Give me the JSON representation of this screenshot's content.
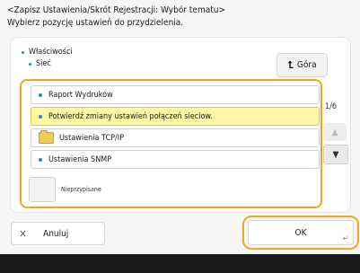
{
  "header": {
    "line1": "<Zapisz Ustawienia/Skrót Rejestracji: Wybór tematu>",
    "line2": "Wybierz pozycję ustawień do przydzielenia."
  },
  "tree": {
    "parent": "Właściwości",
    "child": "Sieć"
  },
  "up_button": {
    "label": "Góra",
    "icon": "up-arrow-icon"
  },
  "list": {
    "items": [
      {
        "label": "Raport Wydruków",
        "type": "item"
      },
      {
        "label": "Potwierdź zmiany ustawień połączeń sieciow.",
        "type": "item",
        "selected": true
      },
      {
        "label": "Ustawienia TCP/IP",
        "type": "folder"
      },
      {
        "label": "Ustawienia SNMP",
        "type": "item"
      }
    ],
    "unassigned_label": "Nieprzypisane"
  },
  "pagination": {
    "text": "1/6"
  },
  "buttons": {
    "cancel": "Anuluj",
    "ok": "OK"
  },
  "colors": {
    "highlight": "#f0a81e",
    "selected_bg": "#fff7a8",
    "bullet": "#2b86c6"
  }
}
